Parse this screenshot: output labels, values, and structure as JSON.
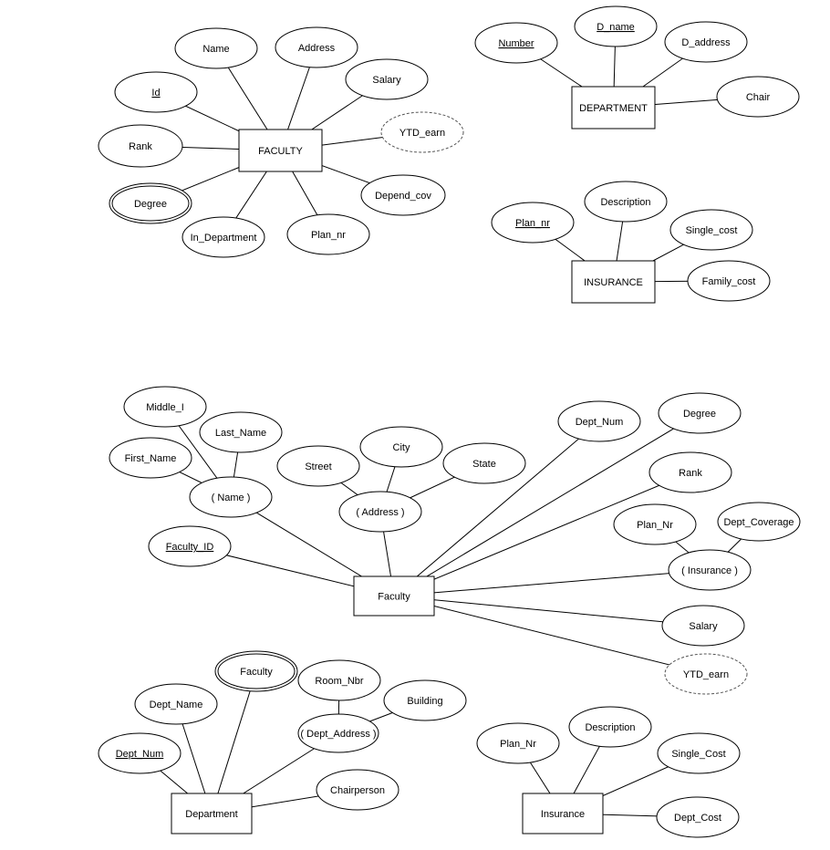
{
  "diagrams": [
    {
      "entity": "FACULTY",
      "attributes": [
        {
          "label": "Name",
          "kind": "simple",
          "parent": null
        },
        {
          "label": "Address",
          "kind": "simple",
          "parent": null
        },
        {
          "label": "Salary",
          "kind": "simple",
          "parent": null
        },
        {
          "label": "Id",
          "kind": "key",
          "parent": null
        },
        {
          "label": "YTD_earn",
          "kind": "derived",
          "parent": null
        },
        {
          "label": "Rank",
          "kind": "simple",
          "parent": null
        },
        {
          "label": "Degree",
          "kind": "multivalued",
          "parent": null
        },
        {
          "label": "Depend_cov",
          "kind": "simple",
          "parent": null
        },
        {
          "label": "In_Department",
          "kind": "simple",
          "parent": null
        },
        {
          "label": "Plan_nr",
          "kind": "simple",
          "parent": null
        }
      ]
    },
    {
      "entity": "DEPARTMENT",
      "attributes": [
        {
          "label": "Number",
          "kind": "key",
          "parent": null
        },
        {
          "label": "D_name",
          "kind": "key",
          "parent": null
        },
        {
          "label": "D_address",
          "kind": "simple",
          "parent": null
        },
        {
          "label": "Chair",
          "kind": "simple",
          "parent": null
        }
      ]
    },
    {
      "entity": "INSURANCE",
      "attributes": [
        {
          "label": "Plan_nr",
          "kind": "key",
          "parent": null
        },
        {
          "label": "Description",
          "kind": "simple",
          "parent": null
        },
        {
          "label": "Single_cost",
          "kind": "simple",
          "parent": null
        },
        {
          "label": "Family_cost",
          "kind": "simple",
          "parent": null
        }
      ]
    },
    {
      "entity": "Faculty",
      "attributes": [
        {
          "label": "( Name )",
          "kind": "composite",
          "parent": null
        },
        {
          "label": "Middle_I",
          "kind": "simple",
          "parent": 0
        },
        {
          "label": "Last_Name",
          "kind": "simple",
          "parent": 0
        },
        {
          "label": "First_Name",
          "kind": "simple",
          "parent": 0
        },
        {
          "label": "( Address )",
          "kind": "composite",
          "parent": null
        },
        {
          "label": "Street",
          "kind": "simple",
          "parent": 4
        },
        {
          "label": "City",
          "kind": "simple",
          "parent": 4
        },
        {
          "label": "State",
          "kind": "simple",
          "parent": 4
        },
        {
          "label": "Faculty_ID",
          "kind": "key",
          "parent": null
        },
        {
          "label": "Dept_Num",
          "kind": "simple",
          "parent": null
        },
        {
          "label": "Degree",
          "kind": "simple",
          "parent": null
        },
        {
          "label": "Rank",
          "kind": "simple",
          "parent": null
        },
        {
          "label": "( Insurance )",
          "kind": "composite",
          "parent": null
        },
        {
          "label": "Plan_Nr",
          "kind": "simple",
          "parent": 12
        },
        {
          "label": "Dept_Coverage",
          "kind": "simple",
          "parent": 12
        },
        {
          "label": "Salary",
          "kind": "simple",
          "parent": null
        },
        {
          "label": "YTD_earn",
          "kind": "derived",
          "parent": null
        }
      ]
    },
    {
      "entity": "Department",
      "attributes": [
        {
          "label": "Faculty",
          "kind": "multivalued",
          "parent": null
        },
        {
          "label": "( Dept_Address )",
          "kind": "composite",
          "parent": null
        },
        {
          "label": "Room_Nbr",
          "kind": "simple",
          "parent": 1
        },
        {
          "label": "Building",
          "kind": "simple",
          "parent": 1
        },
        {
          "label": "Dept_Name",
          "kind": "simple",
          "parent": null
        },
        {
          "label": "Dept_Num",
          "kind": "key",
          "parent": null
        },
        {
          "label": "Chairperson",
          "kind": "simple",
          "parent": null
        }
      ]
    },
    {
      "entity": "Insurance",
      "attributes": [
        {
          "label": "Plan_Nr",
          "kind": "simple",
          "parent": null
        },
        {
          "label": "Description",
          "kind": "simple",
          "parent": null
        },
        {
          "label": "Single_Cost",
          "kind": "simple",
          "parent": null
        },
        {
          "label": "Dept_Cost",
          "kind": "simple",
          "parent": null
        }
      ]
    }
  ]
}
